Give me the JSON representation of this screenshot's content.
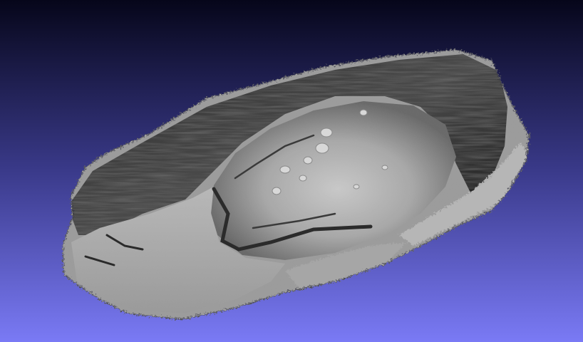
{
  "viewer": {
    "background_top": "#06061a",
    "background_mid": "#3a3a8a",
    "background_bottom": "#7a7af5"
  },
  "mesh": {
    "base_color": "#8a8a8a",
    "highlight_color": "#d2d2d2",
    "shadow_color": "#1e1e1e",
    "rough_edge_color": "#b4b4b4"
  }
}
